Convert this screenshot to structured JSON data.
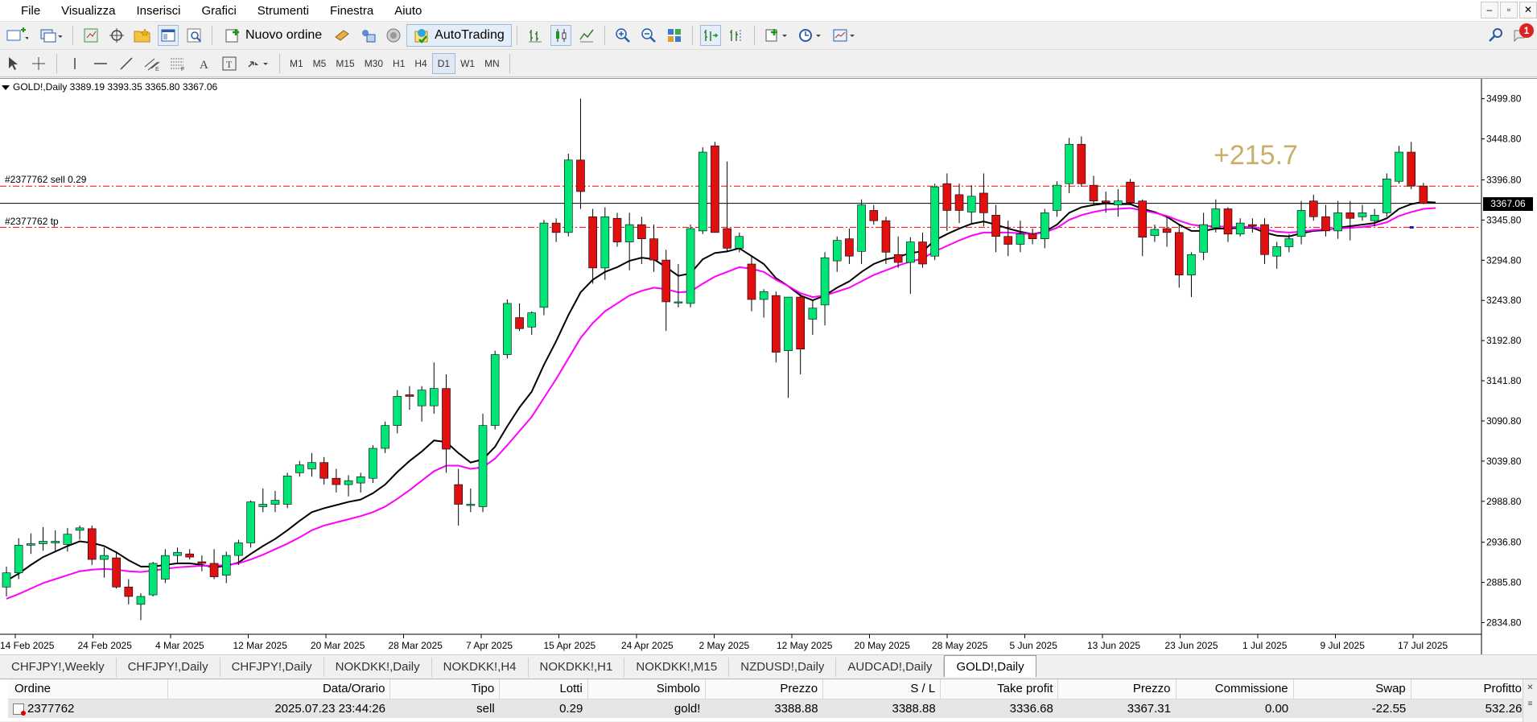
{
  "menu": [
    "File",
    "Visualizza",
    "Inserisci",
    "Grafici",
    "Strumenti",
    "Finestra",
    "Aiuto"
  ],
  "window_controls": [
    "–",
    "▫",
    "✕"
  ],
  "toolbar": {
    "new_order_label": "Nuovo ordine",
    "autotrading_label": "AutoTrading",
    "notification_count": "1",
    "timeframes": [
      "M1",
      "M5",
      "M15",
      "M30",
      "H1",
      "H4",
      "D1",
      "W1",
      "MN"
    ],
    "active_timeframe": "D1"
  },
  "chart": {
    "symbol_info": "GOLD!,Daily  3389.19 3393.35 3365.80 3367.06",
    "order_sell_label": "#2377762 sell 0.29",
    "order_tp_label": "#2377762 tp",
    "profit_overlay": "+215.7",
    "current_price_tag": "3367.06"
  },
  "chart_data": {
    "type": "candlestick",
    "symbol": "GOLD!",
    "timeframe": "Daily",
    "ohlc_last": {
      "open": 3389.19,
      "high": 3393.35,
      "low": 3365.8,
      "close": 3367.06
    },
    "y_ticks": [
      "3499.80",
      "3448.80",
      "3396.80",
      "3345.80",
      "3294.80",
      "3243.80",
      "3192.80",
      "3141.80",
      "3090.80",
      "3039.80",
      "2988.80",
      "2936.80",
      "2885.80",
      "2834.80"
    ],
    "y_tick_values": [
      3499.8,
      3448.8,
      3396.8,
      3345.8,
      3294.8,
      3243.8,
      3192.8,
      3141.8,
      3090.8,
      3039.8,
      2988.8,
      2936.8,
      2885.8,
      2834.8
    ],
    "ylim": [
      2820,
      3525
    ],
    "x_ticks": [
      "14 Feb 2025",
      "24 Feb 2025",
      "4 Mar 2025",
      "12 Mar 2025",
      "20 Mar 2025",
      "28 Mar 2025",
      "7 Apr 2025",
      "15 Apr 2025",
      "24 Apr 2025",
      "2 May 2025",
      "12 May 2025",
      "20 May 2025",
      "28 May 2025",
      "5 Jun 2025",
      "13 Jun 2025",
      "23 Jun 2025",
      "1 Jul 2025",
      "9 Jul 2025",
      "17 Jul 2025"
    ],
    "horizontal_lines": [
      {
        "name": "sell entry",
        "value": 3388.88,
        "style": "dash-dot",
        "color": "#ff0000"
      },
      {
        "name": "take profit",
        "value": 3336.68,
        "style": "dash-dot",
        "color": "#ff0000"
      },
      {
        "name": "current price",
        "value": 3367.06,
        "style": "solid",
        "color": "#000000"
      }
    ],
    "candles": [
      {
        "o": 2880,
        "h": 2906,
        "l": 2868,
        "c": 2898
      },
      {
        "o": 2898,
        "h": 2942,
        "l": 2890,
        "c": 2933
      },
      {
        "o": 2933,
        "h": 2948,
        "l": 2922,
        "c": 2935
      },
      {
        "o": 2935,
        "h": 2956,
        "l": 2926,
        "c": 2938
      },
      {
        "o": 2936,
        "h": 2952,
        "l": 2925,
        "c": 2938
      },
      {
        "o": 2934,
        "h": 2955,
        "l": 2925,
        "c": 2947
      },
      {
        "o": 2952,
        "h": 2958,
        "l": 2940,
        "c": 2955
      },
      {
        "o": 2954,
        "h": 2958,
        "l": 2908,
        "c": 2915
      },
      {
        "o": 2915,
        "h": 2930,
        "l": 2892,
        "c": 2920
      },
      {
        "o": 2917,
        "h": 2925,
        "l": 2878,
        "c": 2880
      },
      {
        "o": 2880,
        "h": 2890,
        "l": 2858,
        "c": 2868
      },
      {
        "o": 2858,
        "h": 2872,
        "l": 2838,
        "c": 2868
      },
      {
        "o": 2870,
        "h": 2912,
        "l": 2868,
        "c": 2910
      },
      {
        "o": 2890,
        "h": 2928,
        "l": 2885,
        "c": 2920
      },
      {
        "o": 2920,
        "h": 2930,
        "l": 2910,
        "c": 2924
      },
      {
        "o": 2922,
        "h": 2928,
        "l": 2915,
        "c": 2918
      },
      {
        "o": 2912,
        "h": 2920,
        "l": 2900,
        "c": 2910
      },
      {
        "o": 2910,
        "h": 2928,
        "l": 2890,
        "c": 2893
      },
      {
        "o": 2895,
        "h": 2925,
        "l": 2885,
        "c": 2920
      },
      {
        "o": 2920,
        "h": 2940,
        "l": 2908,
        "c": 2936
      },
      {
        "o": 2936,
        "h": 2990,
        "l": 2930,
        "c": 2988
      },
      {
        "o": 2982,
        "h": 3005,
        "l": 2975,
        "c": 2985
      },
      {
        "o": 2985,
        "h": 3002,
        "l": 2975,
        "c": 2990
      },
      {
        "o": 2985,
        "h": 3025,
        "l": 2980,
        "c": 3021
      },
      {
        "o": 3025,
        "h": 3040,
        "l": 3020,
        "c": 3035
      },
      {
        "o": 3030,
        "h": 3050,
        "l": 3020,
        "c": 3038
      },
      {
        "o": 3038,
        "h": 3045,
        "l": 3010,
        "c": 3018
      },
      {
        "o": 3018,
        "h": 3030,
        "l": 3000,
        "c": 3010
      },
      {
        "o": 3010,
        "h": 3022,
        "l": 2995,
        "c": 3015
      },
      {
        "o": 3012,
        "h": 3025,
        "l": 3000,
        "c": 3020
      },
      {
        "o": 3018,
        "h": 3060,
        "l": 3012,
        "c": 3056
      },
      {
        "o": 3056,
        "h": 3090,
        "l": 3050,
        "c": 3085
      },
      {
        "o": 3085,
        "h": 3130,
        "l": 3075,
        "c": 3122
      },
      {
        "o": 3124,
        "h": 3135,
        "l": 3105,
        "c": 3122
      },
      {
        "o": 3110,
        "h": 3135,
        "l": 3090,
        "c": 3130
      },
      {
        "o": 3110,
        "h": 3165,
        "l": 3100,
        "c": 3132
      },
      {
        "o": 3132,
        "h": 3150,
        "l": 3025,
        "c": 3055
      },
      {
        "o": 3010,
        "h": 3030,
        "l": 2958,
        "c": 2985
      },
      {
        "o": 2985,
        "h": 3005,
        "l": 2975,
        "c": 2985
      },
      {
        "o": 2982,
        "h": 3100,
        "l": 2975,
        "c": 3085
      },
      {
        "o": 3085,
        "h": 3180,
        "l": 3080,
        "c": 3175
      },
      {
        "o": 3175,
        "h": 3245,
        "l": 3170,
        "c": 3240
      },
      {
        "o": 3222,
        "h": 3240,
        "l": 3205,
        "c": 3208
      },
      {
        "o": 3210,
        "h": 3230,
        "l": 3200,
        "c": 3228
      },
      {
        "o": 3235,
        "h": 3346,
        "l": 3225,
        "c": 3342
      },
      {
        "o": 3342,
        "h": 3348,
        "l": 3318,
        "c": 3330
      },
      {
        "o": 3330,
        "h": 3430,
        "l": 3325,
        "c": 3422
      },
      {
        "o": 3422,
        "h": 3500,
        "l": 3360,
        "c": 3382
      },
      {
        "o": 3350,
        "h": 3360,
        "l": 3265,
        "c": 3285
      },
      {
        "o": 3285,
        "h": 3362,
        "l": 3270,
        "c": 3350
      },
      {
        "o": 3348,
        "h": 3355,
        "l": 3312,
        "c": 3318
      },
      {
        "o": 3318,
        "h": 3355,
        "l": 3282,
        "c": 3340
      },
      {
        "o": 3340,
        "h": 3350,
        "l": 3290,
        "c": 3322
      },
      {
        "o": 3322,
        "h": 3340,
        "l": 3280,
        "c": 3295
      },
      {
        "o": 3295,
        "h": 3308,
        "l": 3205,
        "c": 3242
      },
      {
        "o": 3242,
        "h": 3290,
        "l": 3235,
        "c": 3242
      },
      {
        "o": 3240,
        "h": 3340,
        "l": 3235,
        "c": 3335
      },
      {
        "o": 3332,
        "h": 3438,
        "l": 3328,
        "c": 3432
      },
      {
        "o": 3440,
        "h": 3445,
        "l": 3330,
        "c": 3330
      },
      {
        "o": 3335,
        "h": 3420,
        "l": 3305,
        "c": 3310
      },
      {
        "o": 3310,
        "h": 3330,
        "l": 3305,
        "c": 3325
      },
      {
        "o": 3290,
        "h": 3300,
        "l": 3230,
        "c": 3245
      },
      {
        "o": 3245,
        "h": 3258,
        "l": 3222,
        "c": 3255
      },
      {
        "o": 3250,
        "h": 3255,
        "l": 3165,
        "c": 3178
      },
      {
        "o": 3180,
        "h": 3248,
        "l": 3120,
        "c": 3248
      },
      {
        "o": 3248,
        "h": 3252,
        "l": 3150,
        "c": 3182
      },
      {
        "o": 3220,
        "h": 3245,
        "l": 3200,
        "c": 3234
      },
      {
        "o": 3238,
        "h": 3305,
        "l": 3212,
        "c": 3298
      },
      {
        "o": 3294,
        "h": 3325,
        "l": 3280,
        "c": 3320
      },
      {
        "o": 3322,
        "h": 3335,
        "l": 3290,
        "c": 3300
      },
      {
        "o": 3306,
        "h": 3372,
        "l": 3290,
        "c": 3365
      },
      {
        "o": 3358,
        "h": 3365,
        "l": 3340,
        "c": 3345
      },
      {
        "o": 3345,
        "h": 3350,
        "l": 3290,
        "c": 3305
      },
      {
        "o": 3302,
        "h": 3325,
        "l": 3285,
        "c": 3292
      },
      {
        "o": 3292,
        "h": 3324,
        "l": 3252,
        "c": 3318
      },
      {
        "o": 3318,
        "h": 3330,
        "l": 3285,
        "c": 3290
      },
      {
        "o": 3300,
        "h": 3392,
        "l": 3295,
        "c": 3388
      },
      {
        "o": 3392,
        "h": 3405,
        "l": 3332,
        "c": 3358
      },
      {
        "o": 3378,
        "h": 3392,
        "l": 3342,
        "c": 3358
      },
      {
        "o": 3356,
        "h": 3390,
        "l": 3342,
        "c": 3376
      },
      {
        "o": 3380,
        "h": 3405,
        "l": 3338,
        "c": 3355
      },
      {
        "o": 3352,
        "h": 3365,
        "l": 3305,
        "c": 3325
      },
      {
        "o": 3325,
        "h": 3345,
        "l": 3300,
        "c": 3315
      },
      {
        "o": 3315,
        "h": 3345,
        "l": 3305,
        "c": 3328
      },
      {
        "o": 3328,
        "h": 3335,
        "l": 3315,
        "c": 3322
      },
      {
        "o": 3322,
        "h": 3360,
        "l": 3310,
        "c": 3355
      },
      {
        "o": 3358,
        "h": 3395,
        "l": 3350,
        "c": 3390
      },
      {
        "o": 3392,
        "h": 3450,
        "l": 3380,
        "c": 3442
      },
      {
        "o": 3442,
        "h": 3452,
        "l": 3388,
        "c": 3392
      },
      {
        "o": 3390,
        "h": 3402,
        "l": 3366,
        "c": 3370
      },
      {
        "o": 3370,
        "h": 3382,
        "l": 3355,
        "c": 3368
      },
      {
        "o": 3365,
        "h": 3385,
        "l": 3350,
        "c": 3370
      },
      {
        "o": 3394,
        "h": 3398,
        "l": 3365,
        "c": 3368
      },
      {
        "o": 3370,
        "h": 3372,
        "l": 3300,
        "c": 3324
      },
      {
        "o": 3326,
        "h": 3340,
        "l": 3318,
        "c": 3334
      },
      {
        "o": 3335,
        "h": 3350,
        "l": 3312,
        "c": 3330
      },
      {
        "o": 3330,
        "h": 3340,
        "l": 3260,
        "c": 3276
      },
      {
        "o": 3276,
        "h": 3305,
        "l": 3248,
        "c": 3302
      },
      {
        "o": 3305,
        "h": 3355,
        "l": 3295,
        "c": 3340
      },
      {
        "o": 3336,
        "h": 3372,
        "l": 3330,
        "c": 3360
      },
      {
        "o": 3360,
        "h": 3362,
        "l": 3318,
        "c": 3328
      },
      {
        "o": 3328,
        "h": 3348,
        "l": 3325,
        "c": 3342
      },
      {
        "o": 3340,
        "h": 3348,
        "l": 3330,
        "c": 3338
      },
      {
        "o": 3340,
        "h": 3348,
        "l": 3290,
        "c": 3302
      },
      {
        "o": 3300,
        "h": 3318,
        "l": 3284,
        "c": 3312
      },
      {
        "o": 3312,
        "h": 3328,
        "l": 3305,
        "c": 3322
      },
      {
        "o": 3325,
        "h": 3370,
        "l": 3315,
        "c": 3358
      },
      {
        "o": 3370,
        "h": 3378,
        "l": 3345,
        "c": 3350
      },
      {
        "o": 3350,
        "h": 3365,
        "l": 3325,
        "c": 3332
      },
      {
        "o": 3332,
        "h": 3370,
        "l": 3322,
        "c": 3355
      },
      {
        "o": 3355,
        "h": 3370,
        "l": 3320,
        "c": 3348
      },
      {
        "o": 3350,
        "h": 3365,
        "l": 3345,
        "c": 3355
      },
      {
        "o": 3345,
        "h": 3360,
        "l": 3338,
        "c": 3352
      },
      {
        "o": 3355,
        "h": 3405,
        "l": 3350,
        "c": 3398
      },
      {
        "o": 3395,
        "h": 3440,
        "l": 3392,
        "c": 3432
      },
      {
        "o": 3432,
        "h": 3445,
        "l": 3385,
        "c": 3389
      },
      {
        "o": 3389,
        "h": 3393,
        "l": 3366,
        "c": 3367
      }
    ],
    "series": [
      {
        "name": "MA black",
        "color": "#000000",
        "values": [
          2888,
          2897,
          2908,
          2918,
          2925,
          2932,
          2938,
          2936,
          2932,
          2924,
          2914,
          2906,
          2906,
          2908,
          2910,
          2910,
          2908,
          2905,
          2907,
          2911,
          2922,
          2932,
          2941,
          2952,
          2964,
          2975,
          2980,
          2984,
          2988,
          2991,
          2999,
          3010,
          3026,
          3040,
          3052,
          3066,
          3064,
          3050,
          3038,
          3042,
          3058,
          3084,
          3108,
          3128,
          3162,
          3192,
          3225,
          3254,
          3270,
          3280,
          3286,
          3294,
          3298,
          3296,
          3286,
          3275,
          3278,
          3296,
          3304,
          3306,
          3310,
          3300,
          3290,
          3272,
          3262,
          3250,
          3244,
          3250,
          3260,
          3268,
          3280,
          3290,
          3296,
          3299,
          3304,
          3306,
          3320,
          3328,
          3335,
          3341,
          3344,
          3340,
          3335,
          3331,
          3328,
          3331,
          3340,
          3355,
          3362,
          3365,
          3367,
          3366,
          3366,
          3360,
          3356,
          3350,
          3340,
          3332,
          3332,
          3335,
          3335,
          3336,
          3336,
          3330,
          3326,
          3325,
          3329,
          3332,
          3333,
          3336,
          3338,
          3340,
          3342,
          3348,
          3360,
          3366,
          3369,
          3368
        ]
      },
      {
        "name": "MA magenta",
        "color": "#ff00ff",
        "values": [
          2865,
          2871,
          2878,
          2885,
          2890,
          2895,
          2900,
          2902,
          2903,
          2902,
          2900,
          2899,
          2901,
          2903,
          2905,
          2906,
          2907,
          2907,
          2908,
          2910,
          2915,
          2921,
          2928,
          2935,
          2943,
          2952,
          2958,
          2962,
          2966,
          2970,
          2975,
          2982,
          2992,
          3003,
          3015,
          3027,
          3034,
          3034,
          3030,
          3032,
          3043,
          3060,
          3078,
          3096,
          3120,
          3144,
          3170,
          3196,
          3215,
          3230,
          3240,
          3250,
          3256,
          3260,
          3258,
          3254,
          3255,
          3265,
          3274,
          3280,
          3286,
          3284,
          3280,
          3270,
          3262,
          3253,
          3248,
          3250,
          3255,
          3260,
          3268,
          3276,
          3282,
          3288,
          3293,
          3297,
          3306,
          3313,
          3320,
          3326,
          3330,
          3330,
          3330,
          3329,
          3328,
          3330,
          3336,
          3346,
          3352,
          3356,
          3359,
          3360,
          3361,
          3358,
          3355,
          3351,
          3345,
          3340,
          3338,
          3338,
          3337,
          3337,
          3337,
          3334,
          3331,
          3330,
          3331,
          3333,
          3334,
          3335,
          3336,
          3337,
          3339,
          3343,
          3351,
          3356,
          3360,
          3361
        ]
      }
    ]
  },
  "tabs": [
    "CHFJPY!,Weekly",
    "CHFJPY!,Daily",
    "CHFJPY!,Daily",
    "NOKDKK!,Daily",
    "NOKDKK!,H4",
    "NOKDKK!,H1",
    "NOKDKK!,M15",
    "NZDUSD!,Daily",
    "AUDCAD!,Daily",
    "GOLD!,Daily"
  ],
  "active_tab": "GOLD!,Daily",
  "orders": {
    "headers": [
      "Ordine",
      "Data/Orario",
      "Tipo",
      "Lotti",
      "Simbolo",
      "Prezzo",
      "S / L",
      "Take profit",
      "Prezzo",
      "Commissione",
      "Swap",
      "Profitto"
    ],
    "rows": [
      [
        "2377762",
        "2025.07.23 23:44:26",
        "sell",
        "0.29",
        "gold!",
        "3388.88",
        "3388.88",
        "3336.68",
        "3367.31",
        "0.00",
        "-22.55",
        "532.26"
      ]
    ]
  }
}
